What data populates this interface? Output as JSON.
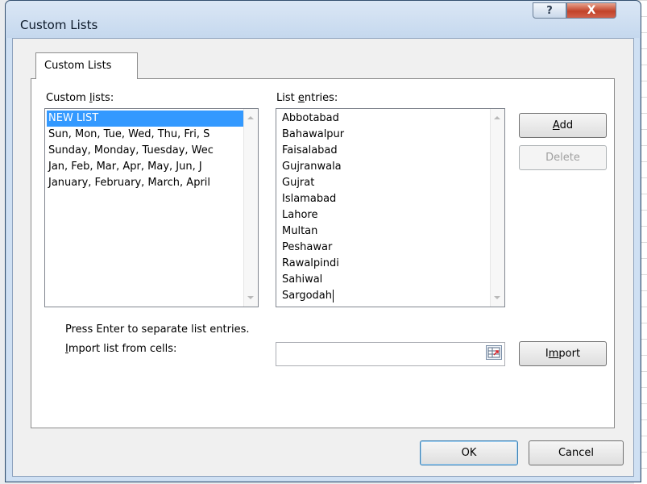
{
  "window": {
    "title": "Custom Lists",
    "help_glyph": "?",
    "close_glyph": "X"
  },
  "tab": {
    "label": "Custom Lists"
  },
  "custom_lists": {
    "label": "Custom lists:",
    "items": [
      {
        "text": "NEW LIST",
        "selected": true
      },
      {
        "text": "Sun, Mon, Tue, Wed, Thu, Fri, S",
        "selected": false
      },
      {
        "text": "Sunday, Monday, Tuesday, Wec",
        "selected": false
      },
      {
        "text": "Jan, Feb, Mar, Apr, May, Jun, J",
        "selected": false
      },
      {
        "text": "January, February, March, April",
        "selected": false
      }
    ]
  },
  "list_entries": {
    "label": "List entries:",
    "items": [
      "Abbotabad",
      "Bahawalpur",
      "Faisalabad",
      "Gujranwala",
      "Gujrat",
      "Islamabad",
      "Lahore",
      "Multan",
      "Peshawar",
      "Rawalpindi",
      "Sahiwal",
      "Sargodah"
    ]
  },
  "buttons": {
    "add": "Add",
    "delete": "Delete",
    "import": "Import",
    "ok": "OK",
    "cancel": "Cancel"
  },
  "hint": "Press Enter to separate list entries.",
  "import": {
    "label": "Import list from cells:",
    "value": ""
  },
  "colors": {
    "selection": "#3399ff",
    "close": "#c2432a",
    "frame": "#cfe0f3"
  }
}
